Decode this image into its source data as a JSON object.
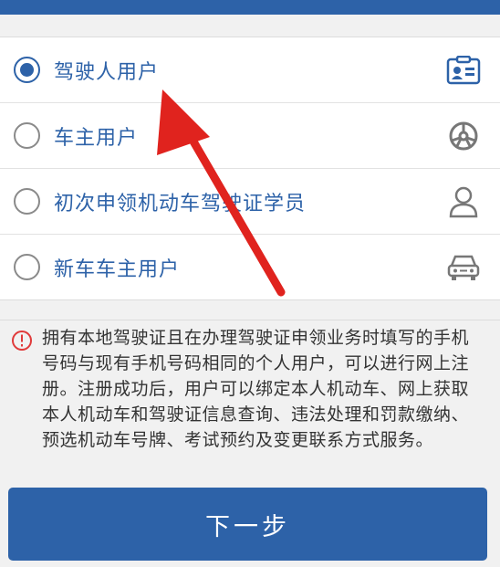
{
  "options": [
    {
      "label": "驾驶人用户",
      "icon": "id-card-icon",
      "selected": true
    },
    {
      "label": "车主用户",
      "icon": "steering-wheel-icon",
      "selected": false
    },
    {
      "label": "初次申领机动车驾驶证学员",
      "icon": "person-icon",
      "selected": false
    },
    {
      "label": "新车车主用户",
      "icon": "car-icon",
      "selected": false
    }
  ],
  "notice": {
    "icon": "info-icon",
    "text": "拥有本地驾驶证且在办理驾驶证申领业务时填写的手机号码与现有手机号码相同的个人用户，可以进行网上注册。注册成功后，用户可以绑定本人机动车、网上获取本人机动车和驾驶证信息查询、违法处理和罚款缴纳、预选机动车号牌、考试预约及变更联系方式服务。"
  },
  "next_button": {
    "label": "下一步"
  },
  "colors": {
    "primary": "#2d62a8",
    "annotation_arrow": "#e0231e",
    "notice_icon": "#e03a3a"
  }
}
